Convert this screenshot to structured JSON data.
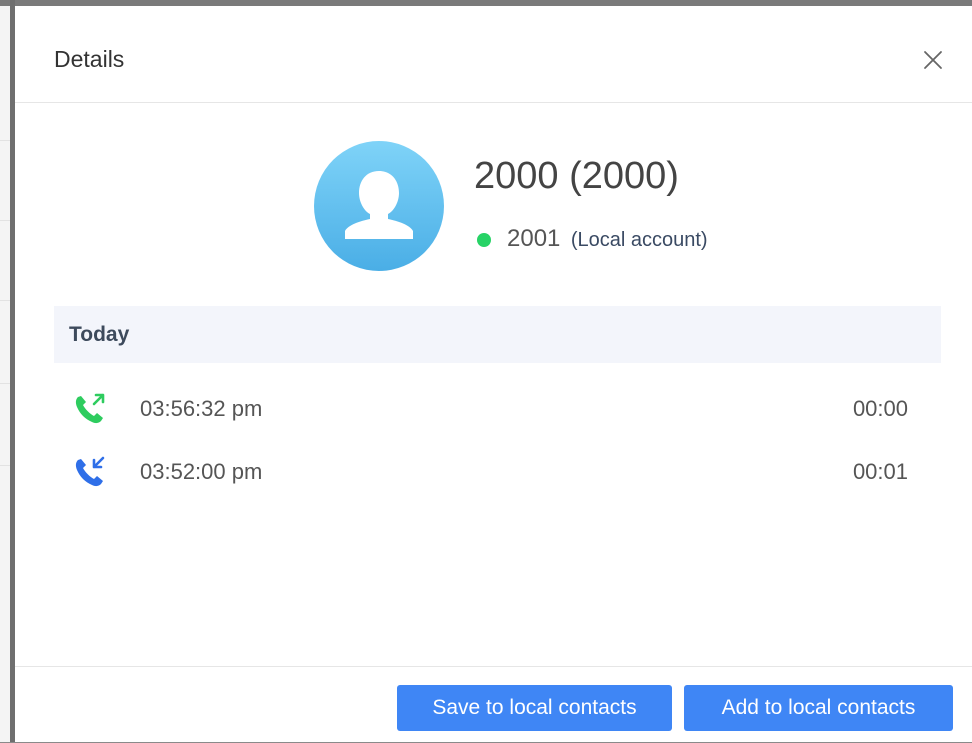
{
  "dialog": {
    "title": "Details",
    "close_icon": "close-icon"
  },
  "contact": {
    "avatar_icon": "person-icon",
    "name": "2000 (2000)",
    "status_color": "#27d366",
    "account_number": "2001",
    "account_type": "(Local account)"
  },
  "history": {
    "section_label": "Today",
    "calls": [
      {
        "direction": "outgoing",
        "icon": "outgoing-call-icon",
        "icon_color": "#2ecc5f",
        "time": "03:56:32 pm",
        "duration": "00:00"
      },
      {
        "direction": "incoming",
        "icon": "incoming-call-icon",
        "icon_color": "#2f6fe8",
        "time": "03:52:00 pm",
        "duration": "00:01"
      }
    ]
  },
  "footer": {
    "save_label": "Save to local contacts",
    "add_label": "Add to local contacts"
  },
  "colors": {
    "accent": "#3f86f5",
    "section_bg": "#f3f5fb"
  }
}
